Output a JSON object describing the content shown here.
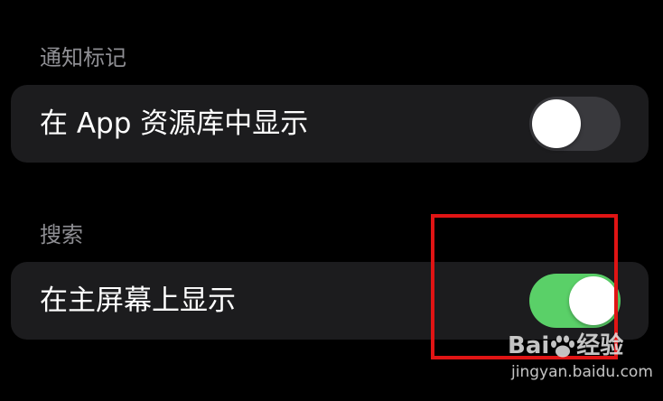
{
  "sections": [
    {
      "header": "通知标记",
      "row": {
        "label": "在 App 资源库中显示",
        "toggle_on": false
      }
    },
    {
      "header": "搜索",
      "row": {
        "label": "在主屏幕上显示",
        "toggle_on": true
      }
    }
  ],
  "watermark": {
    "brand": "Bai",
    "brand_suffix": "经验",
    "url": "jingyan.baidu.com"
  },
  "colors": {
    "background": "#000000",
    "cell": "#1c1c1e",
    "toggle_on": "#5ad068",
    "toggle_off": "#39393d",
    "highlight": "#e01414"
  }
}
